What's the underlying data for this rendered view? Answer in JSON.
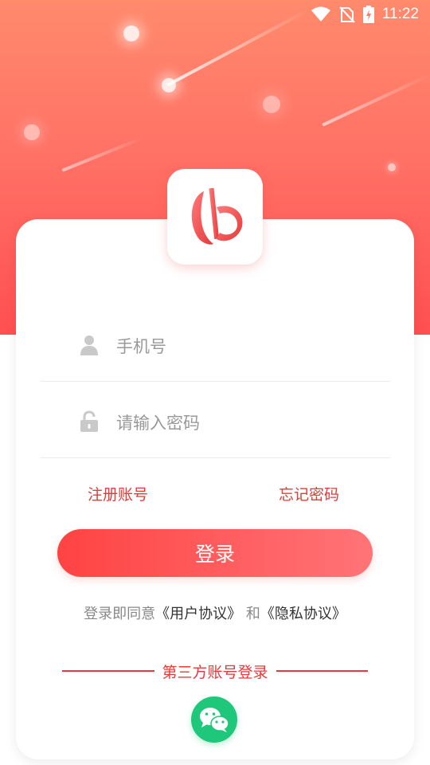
{
  "status_bar": {
    "time": "11:22",
    "icons": [
      "wifi-icon",
      "no-sim-icon",
      "battery-charging-icon"
    ]
  },
  "logo": {
    "icon": "app-logo-icon"
  },
  "form": {
    "phone": {
      "placeholder": "手机号",
      "value": "",
      "icon": "user-icon"
    },
    "password": {
      "placeholder": "请输入密码",
      "value": "",
      "icon": "lock-icon"
    },
    "register_label": "注册账号",
    "forgot_label": "忘记密码",
    "login_label": "登录"
  },
  "agreement": {
    "prefix": "登录即同意",
    "user_agreement": "《用户协议》",
    "conjunction": "和",
    "privacy_policy": "《隐私协议》"
  },
  "third_party": {
    "label": "第三方账号登录",
    "wechat_icon": "wechat-icon"
  },
  "colors": {
    "accent": "#e5393a",
    "hero_top": "#ff8a6c",
    "hero_bottom": "#ff4f51",
    "wechat": "#1fc77a"
  }
}
